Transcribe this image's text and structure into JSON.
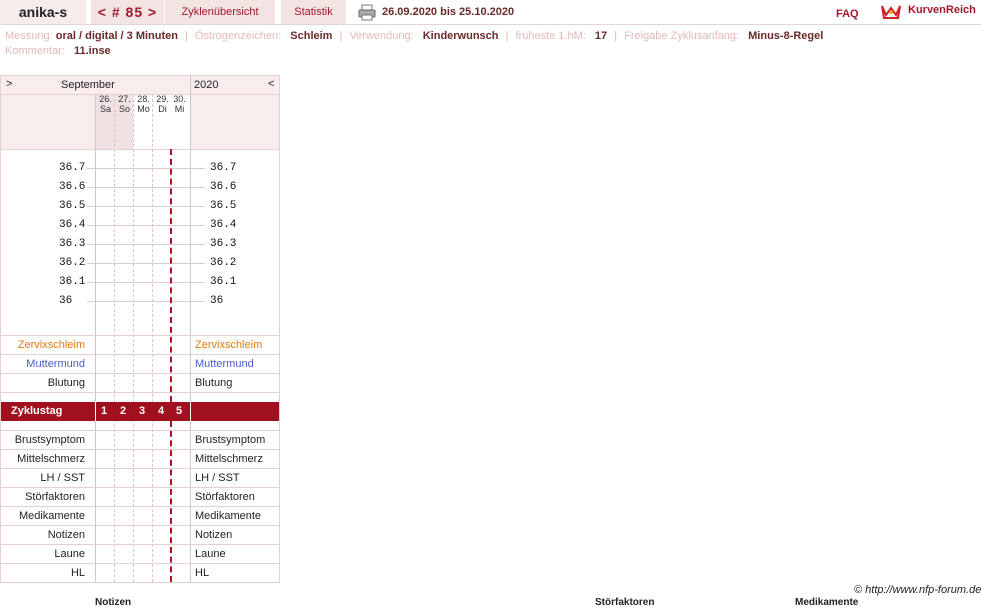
{
  "header": {
    "user": "anika-s",
    "cycle_nav": "< # 85 >",
    "tabs": [
      "Zyklenübersicht",
      "Statistik"
    ],
    "date_range": "26.09.2020 bis 25.10.2020",
    "faq": "FAQ",
    "brand": "KurvenReich",
    "icons": {
      "print": "printer-icon",
      "brand": "crown-icon"
    }
  },
  "info": {
    "messung_label": "Messung:",
    "messung_value": "oral / digital / 3 Minuten",
    "oestrogen_label": "Östrogenzeichen:",
    "oestrogen_value": "Schleim",
    "verwendung_label": "Verwendung:",
    "verwendung_value": "Kinderwunsch",
    "hm_label": "früheste 1.hM:",
    "hm_value": "17",
    "freigabe_label": "Freigabe Zyklusanfang:",
    "freigabe_value": "Minus-8-Regel",
    "kommentar_label": "Kommentar:",
    "kommentar_value": "11.inse"
  },
  "chart": {
    "prev_arrow": ">",
    "next_arrow": "<",
    "month": "September",
    "year": "2020",
    "days": [
      {
        "date": "26.",
        "weekday": "Sa"
      },
      {
        "date": "27.",
        "weekday": "So"
      },
      {
        "date": "28.",
        "weekday": "Mo"
      },
      {
        "date": "29.",
        "weekday": "Di"
      },
      {
        "date": "30.",
        "weekday": "Mi"
      }
    ],
    "temps": [
      "36.7",
      "36.6",
      "36.5",
      "36.4",
      "36.3",
      "36.2",
      "36.1",
      "36"
    ],
    "rows_top": [
      "Zervixschleim",
      "Muttermund",
      "Blutung"
    ],
    "zyklustag_label": "Zyklustag",
    "zyklustage": [
      "1",
      "2",
      "3",
      "4",
      "5"
    ],
    "rows_bottom": [
      "Brustsymptom",
      "Mittelschmerz",
      "LH / SST",
      "Störfaktoren",
      "Medikamente",
      "Notizen",
      "Laune",
      "HL"
    ],
    "colors": {
      "zervix": "#e07a10",
      "muttermund": "#4a5ec0",
      "accent": "#a0101f"
    }
  },
  "footer": {
    "copyright": "© http://www.nfp-forum.de",
    "cut_labels": [
      "Notizen",
      "Störfaktoren",
      "Medikamente"
    ]
  }
}
